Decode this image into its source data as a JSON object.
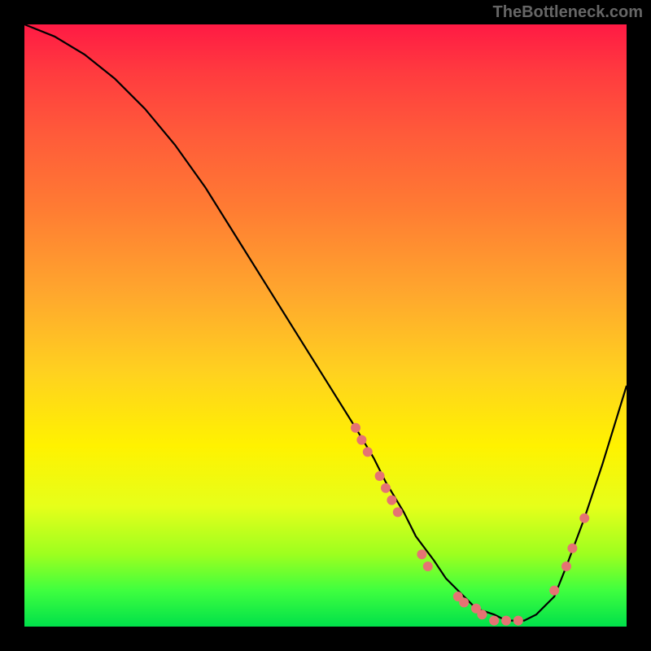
{
  "watermark": "TheBottleneck.com",
  "chart_data": {
    "type": "line",
    "title": "",
    "xlabel": "",
    "ylabel": "",
    "xlim": [
      0,
      100
    ],
    "ylim": [
      0,
      100
    ],
    "series": [
      {
        "name": "curve",
        "x": [
          0,
          5,
          10,
          15,
          20,
          25,
          30,
          35,
          40,
          45,
          50,
          55,
          58,
          60,
          63,
          65,
          68,
          70,
          73,
          75,
          78,
          80,
          83,
          85,
          88,
          90,
          93,
          96,
          100
        ],
        "y": [
          100,
          98,
          95,
          91,
          86,
          80,
          73,
          65,
          57,
          49,
          41,
          33,
          28,
          24,
          19,
          15,
          11,
          8,
          5,
          3,
          2,
          1,
          1,
          2,
          5,
          10,
          18,
          27,
          40
        ]
      }
    ],
    "markers": [
      {
        "x": 55,
        "y": 33
      },
      {
        "x": 56,
        "y": 31
      },
      {
        "x": 57,
        "y": 29
      },
      {
        "x": 59,
        "y": 25
      },
      {
        "x": 60,
        "y": 23
      },
      {
        "x": 61,
        "y": 21
      },
      {
        "x": 62,
        "y": 19
      },
      {
        "x": 66,
        "y": 12
      },
      {
        "x": 67,
        "y": 10
      },
      {
        "x": 72,
        "y": 5
      },
      {
        "x": 73,
        "y": 4
      },
      {
        "x": 75,
        "y": 3
      },
      {
        "x": 76,
        "y": 2
      },
      {
        "x": 78,
        "y": 1
      },
      {
        "x": 80,
        "y": 1
      },
      {
        "x": 82,
        "y": 1
      },
      {
        "x": 88,
        "y": 6
      },
      {
        "x": 90,
        "y": 10
      },
      {
        "x": 91,
        "y": 13
      },
      {
        "x": 93,
        "y": 18
      }
    ],
    "marker_color": "#e57373"
  }
}
